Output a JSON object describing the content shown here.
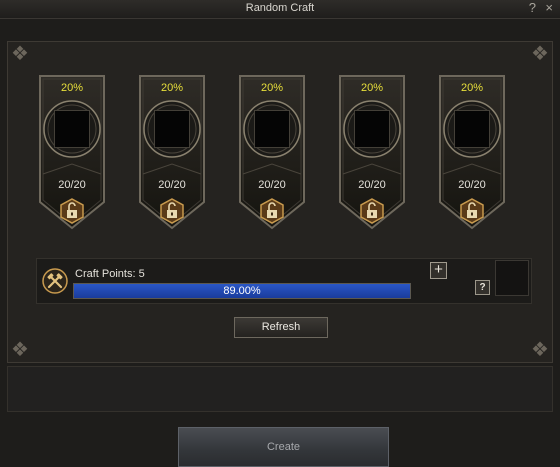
{
  "window": {
    "title": "Random Craft",
    "help_symbol": "?",
    "close_symbol": "×"
  },
  "slots": [
    {
      "percent": "20%",
      "count": "20/20",
      "lock_icon": "unlocked-padlock-icon"
    },
    {
      "percent": "20%",
      "count": "20/20",
      "lock_icon": "unlocked-padlock-icon"
    },
    {
      "percent": "20%",
      "count": "20/20",
      "lock_icon": "unlocked-padlock-icon"
    },
    {
      "percent": "20%",
      "count": "20/20",
      "lock_icon": "unlocked-padlock-icon"
    },
    {
      "percent": "20%",
      "count": "20/20",
      "lock_icon": "unlocked-padlock-icon"
    }
  ],
  "craft": {
    "label": "Craft Points: 5",
    "progress_text": "89.00%",
    "progress_fraction": 1.0,
    "icon": "crossed-hammers-icon",
    "plus_symbol": "+",
    "help_symbol": "?"
  },
  "buttons": {
    "refresh": "Refresh",
    "create": "Create"
  },
  "colors": {
    "percent_text": "#e8df3a",
    "progress_fill": "#2a57c6",
    "gold_accent": "#c89a4e"
  }
}
